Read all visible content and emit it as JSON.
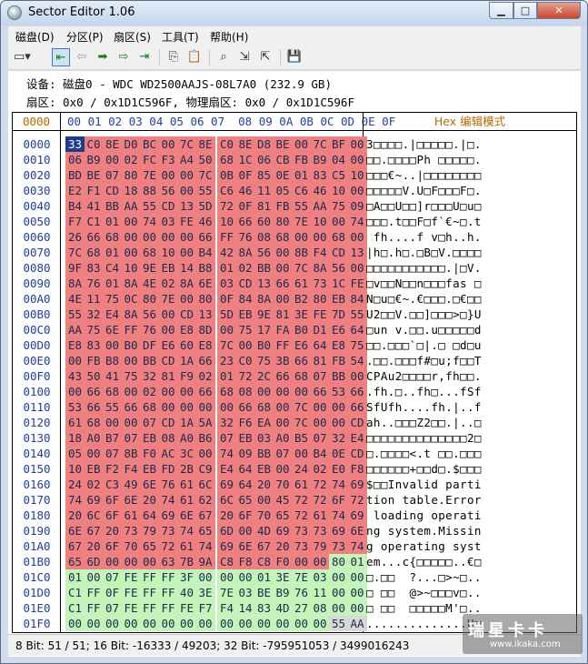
{
  "window": {
    "title": "Sector Editor 1.06"
  },
  "menu": [
    "磁盘(D)",
    "分区(P)",
    "扇区(S)",
    "工具(T)",
    "帮助(H)"
  ],
  "toolbar": {
    "icons": [
      "drive-dropdown-icon",
      "first-sector-icon",
      "back-icon",
      "forward-icon",
      "next-icon",
      "last-sector-icon",
      "copy-icon",
      "paste-icon",
      "search-icon",
      "export-icon",
      "import-icon",
      "save-icon"
    ]
  },
  "info": {
    "line1": "设备: 磁盘0 - WDC WD2500AAJS-08L7A0 (232.9 GB)",
    "line2": "扇区: 0x0 / 0x1D1C596F, 物理扇区: 0x0 / 0x1D1C596F"
  },
  "hex_header": {
    "offset_label": "0000",
    "columns": "00 01 02 03 04 05 06 07  08 09 0A 0B 0C 0D 0E 0F",
    "mode_label": "Hex 编辑模式"
  },
  "rows": [
    {
      "off": "0000",
      "bytes": "33 C0 8E D0 BC 00 7C 8E C0 8E D8 BE 00 7C BF 00",
      "ascii": "3□□□□.|□□□□□.|□."
    },
    {
      "off": "0010",
      "bytes": "06 B9 00 02 FC F3 A4 50 68 1C 06 CB FB B9 04 00",
      "ascii": "□□.□□□□Ph □□□□□."
    },
    {
      "off": "0020",
      "bytes": "BD BE 07 80 7E 00 00 7C 0B 0F 85 0E 01 83 C5 10",
      "ascii": "□□□€~..|□□□□□□□□"
    },
    {
      "off": "0030",
      "bytes": "E2 F1 CD 18 88 56 00 55 C6 46 11 05 C6 46 10 00",
      "ascii": "□□□□□V.U□F□□□F□."
    },
    {
      "off": "0040",
      "bytes": "B4 41 BB AA 55 CD 13 5D 72 0F 81 FB 55 AA 75 09",
      "ascii": "□A□□U□□]r□□□U□u□"
    },
    {
      "off": "0050",
      "bytes": "F7 C1 01 00 74 03 FE 46 10 66 60 80 7E 10 00 74",
      "ascii": "□□□.t□□F□f`€~□.t"
    },
    {
      "off": "0060",
      "bytes": "26 66 68 00 00 00 00 66 FF 76 08 68 00 00 68 00",
      "ascii": " fh....f v□h..h."
    },
    {
      "off": "0070",
      "bytes": "7C 68 01 00 68 10 00 B4 42 8A 56 00 8B F4 CD 13",
      "ascii": "|h□.h□.□B□V.□□□□"
    },
    {
      "off": "0080",
      "bytes": "9F 83 C4 10 9E EB 14 B8 01 02 BB 00 7C 8A 56 00",
      "ascii": "□□□□□□□□□□□.|□V."
    },
    {
      "off": "0090",
      "bytes": "8A 76 01 8A 4E 02 8A 6E 03 CD 13 66 61 73 1C FE",
      "ascii": "□v□□N□□n□□□fas □"
    },
    {
      "off": "00A0",
      "bytes": "4E 11 75 0C 80 7E 00 80 0F 84 8A 00 B2 80 EB 84",
      "ascii": "N□u□€~.€□□□.□€□□"
    },
    {
      "off": "00B0",
      "bytes": "55 32 E4 8A 56 00 CD 13 5D EB 9E 81 3E FE 7D 55",
      "ascii": "U2□□V.□□]□□□>□}U"
    },
    {
      "off": "00C0",
      "bytes": "AA 75 6E FF 76 00 E8 8D 00 75 17 FA B0 D1 E6 64",
      "ascii": "□un v.□□.u□□□□□d"
    },
    {
      "off": "00D0",
      "bytes": "E8 83 00 B0 DF E6 60 E8 7C 00 B0 FF E6 64 E8 75",
      "ascii": "□□.□□□`□|.□ □d□u"
    },
    {
      "off": "00E0",
      "bytes": "00 FB B8 00 BB CD 1A 66 23 C0 75 3B 66 81 FB 54",
      "ascii": ".□□.□□□f#□u;f□□T"
    },
    {
      "off": "00F0",
      "bytes": "43 50 41 75 32 81 F9 02 01 72 2C 66 68 07 BB 00",
      "ascii": "CPAu2□□□□r,fh□□."
    },
    {
      "off": "0100",
      "bytes": "00 66 68 00 02 00 00 66 68 08 00 00 00 66 53 66",
      "ascii": ".fh.□..fh□...fSf"
    },
    {
      "off": "0110",
      "bytes": "53 66 55 66 68 00 00 00 00 66 68 00 7C 00 00 66",
      "ascii": "SfUfh....fh.|..f"
    },
    {
      "off": "0120",
      "bytes": "61 68 00 00 07 CD 1A 5A 32 F6 EA 00 7C 00 00 CD",
      "ascii": "ah..□□□Z2□□.|..□"
    },
    {
      "off": "0130",
      "bytes": "18 A0 B7 07 EB 08 A0 B6 07 EB 03 A0 B5 07 32 E4",
      "ascii": "□□□□□□□□□□□□□□2□"
    },
    {
      "off": "0140",
      "bytes": "05 00 07 8B F0 AC 3C 00 74 09 BB 07 00 B4 0E CD",
      "ascii": "□.□□□□<.t □□.□□□"
    },
    {
      "off": "0150",
      "bytes": "10 EB F2 F4 EB FD 2B C9 E4 64 EB 00 24 02 E0 F8",
      "ascii": "□□□□□□+□□d□.$□□□"
    },
    {
      "off": "0160",
      "bytes": "24 02 C3 49 6E 76 61 6C 69 64 20 70 61 72 74 69",
      "ascii": "$□□Invalid parti"
    },
    {
      "off": "0170",
      "bytes": "74 69 6F 6E 20 74 61 62 6C 65 00 45 72 72 6F 72",
      "ascii": "tion table.Error"
    },
    {
      "off": "0180",
      "bytes": "20 6C 6F 61 64 69 6E 67 20 6F 70 65 72 61 74 69",
      "ascii": " loading operati"
    },
    {
      "off": "0190",
      "bytes": "6E 67 20 73 79 73 74 65 6D 00 4D 69 73 73 69 6E",
      "ascii": "ng system.Missin"
    },
    {
      "off": "01A0",
      "bytes": "67 20 6F 70 65 72 61 74 69 6E 67 20 73 79 73 74",
      "ascii": "g operating syst"
    },
    {
      "off": "01B0",
      "bytes": "65 6D 00 00 00 63 7B 9A C8 F8 C8 F0 00 00 80 01",
      "ascii": "em...c{□□□□□..€□"
    },
    {
      "off": "01C0",
      "bytes": "01 00 07 FE FF FF 3F 00 00 00 01 3E 7E 03 00 00",
      "ascii": "□.□□  ?...□>~□.."
    },
    {
      "off": "01D0",
      "bytes": "C1 FF 0F FE FF FF 40 3E 7E 03 BE B9 76 11 00 00",
      "ascii": "□ □□  @>~□□□v□.."
    },
    {
      "off": "01E0",
      "bytes": "C1 FF 07 FE FF FF FE F7 F4 14 83 4D 27 08 00 00",
      "ascii": "□ □□  □□□□□M'□.."
    },
    {
      "off": "01F0",
      "bytes": "00 00 00 00 00 00 00 00 00 00 00 00 00 00 55 AA",
      "ascii": "..............U□"
    }
  ],
  "status": {
    "text": "8 Bit: 51 / 51;  16 Bit: -16333 / 49203;  32 Bit: -795951053 / 3499016243"
  },
  "watermark": {
    "logo": "瑞星卡卡",
    "url": "www.ikaka.com"
  },
  "colors": {
    "mbr_code": "#f08080",
    "partition_table": "#c3f5b8",
    "signature": "#d8d8d8",
    "cursor": "#1c3c8c",
    "offset_text": "#1f3fa0",
    "header_accent": "#b06a00"
  }
}
